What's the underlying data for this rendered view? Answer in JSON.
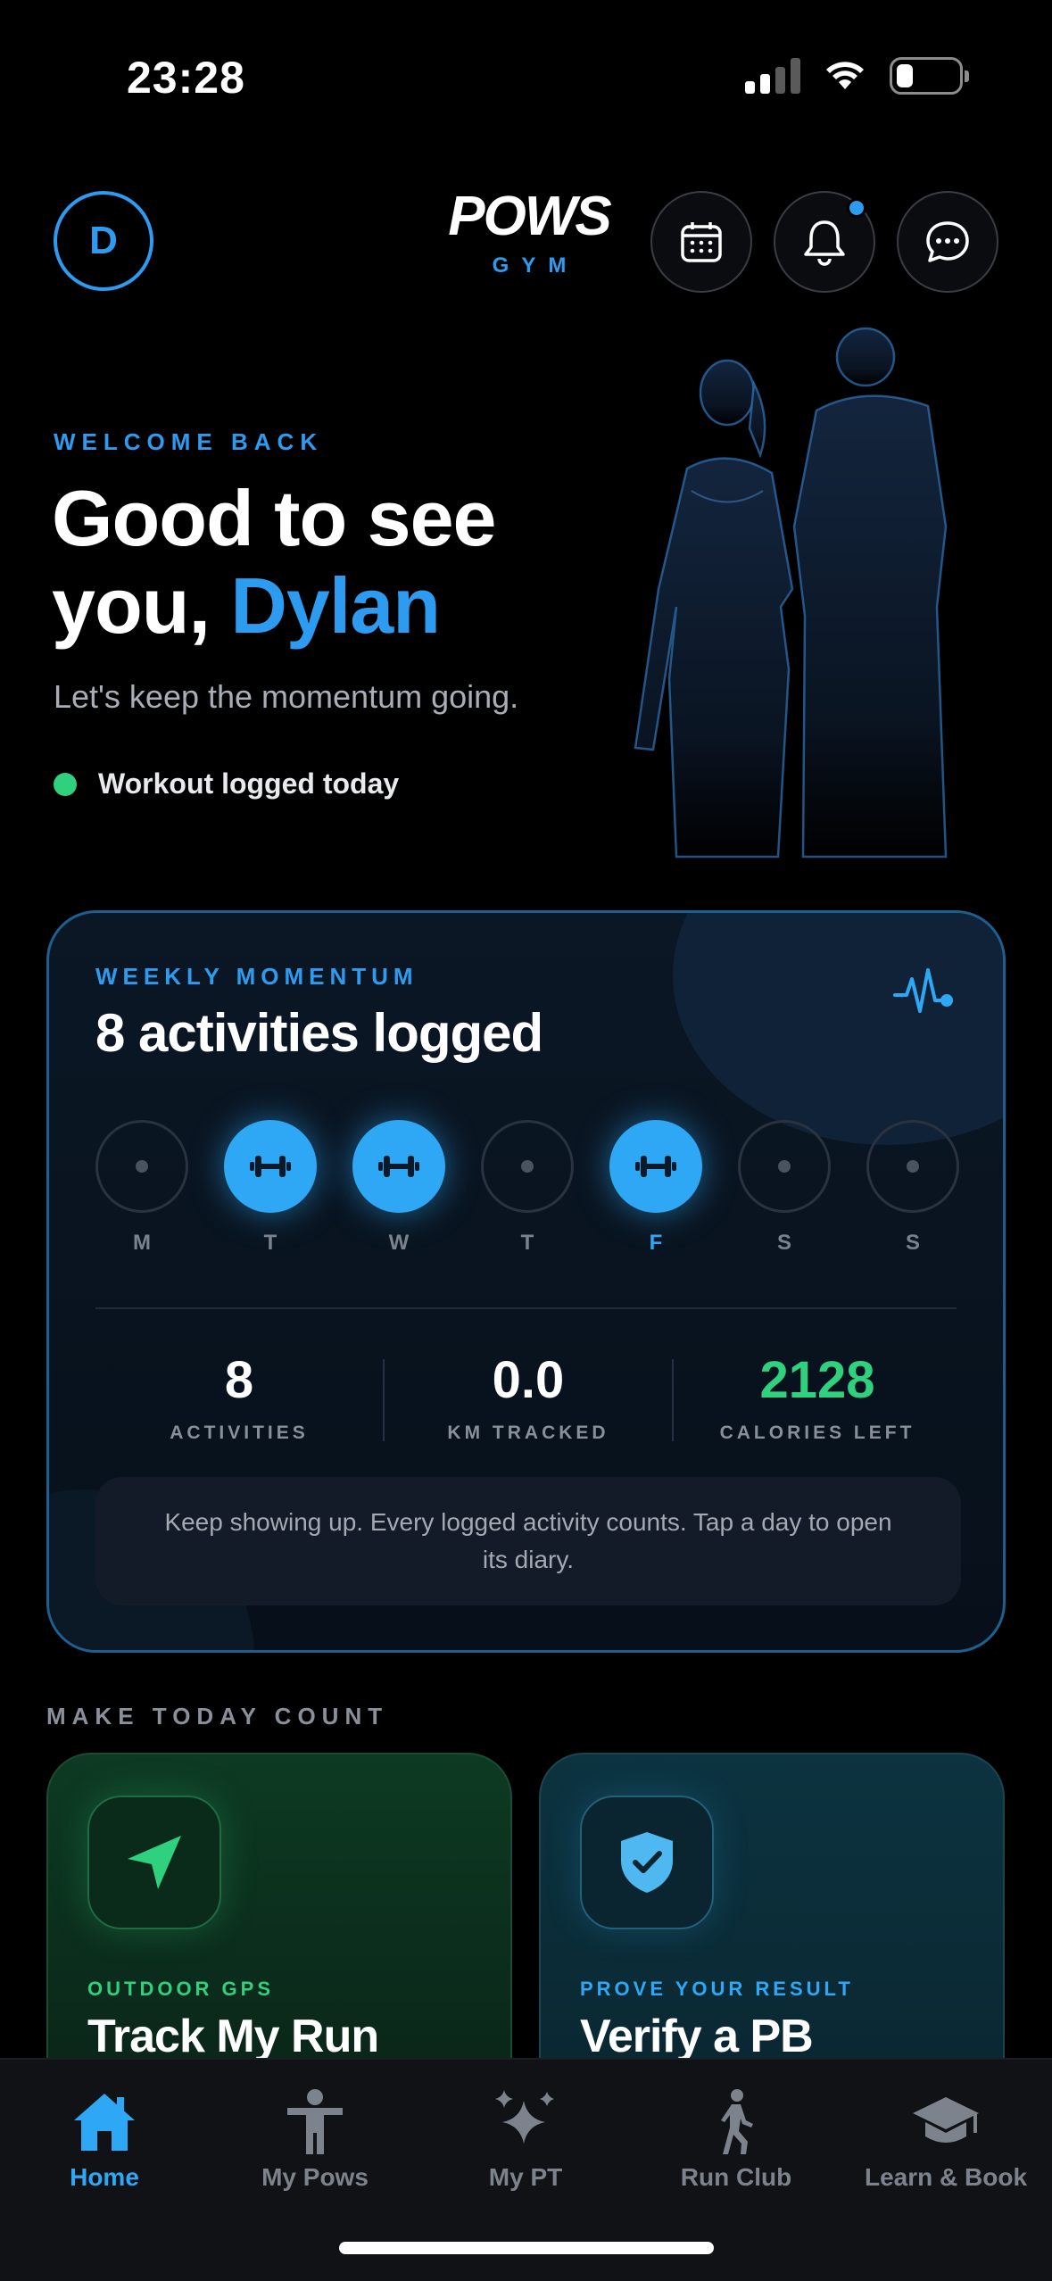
{
  "status_bar": {
    "time": "23:28"
  },
  "header": {
    "avatar_initial": "D",
    "logo_main": "POWS",
    "logo_sub": "GYM",
    "icons": [
      "calendar-icon",
      "bell-icon",
      "chat-icon"
    ],
    "has_notification": true
  },
  "hero": {
    "eyebrow": "WELCOME BACK",
    "greeting_line1": "Good to see",
    "greeting_line2_prefix": "you,",
    "name": "Dylan",
    "subtitle": "Let's keep the momentum going.",
    "status_text": "Workout logged today"
  },
  "weekly": {
    "eyebrow": "WEEKLY MOMENTUM",
    "title": "8 activities logged",
    "days": [
      {
        "letter": "M",
        "active": false,
        "today": false
      },
      {
        "letter": "T",
        "active": true,
        "today": false
      },
      {
        "letter": "W",
        "active": true,
        "today": false
      },
      {
        "letter": "T",
        "active": false,
        "today": false
      },
      {
        "letter": "F",
        "active": true,
        "today": true
      },
      {
        "letter": "S",
        "active": false,
        "today": false
      },
      {
        "letter": "S",
        "active": false,
        "today": false
      }
    ],
    "stats": [
      {
        "value": "8",
        "label": "ACTIVITIES"
      },
      {
        "value": "0.0",
        "label": "KM TRACKED"
      },
      {
        "value": "2128",
        "label": "CALORIES LEFT"
      }
    ],
    "tip": "Keep showing up. Every logged activity counts. Tap a day to open its diary."
  },
  "today": {
    "section_label": "MAKE TODAY COUNT",
    "run": {
      "eyebrow": "OUTDOOR GPS",
      "title": "Track My Run"
    },
    "pb": {
      "eyebrow": "PROVE YOUR RESULT",
      "title": "Verify a PB"
    }
  },
  "tabbar": {
    "tabs": [
      {
        "label": "Home",
        "icon": "home-icon",
        "active": true
      },
      {
        "label": "My Pows",
        "icon": "person-icon",
        "active": false
      },
      {
        "label": "My PT",
        "icon": "sparkles-icon",
        "active": false
      },
      {
        "label": "Run Club",
        "icon": "walker-icon",
        "active": false
      },
      {
        "label": "Learn & Book",
        "icon": "graduation-cap-icon",
        "active": false
      }
    ]
  },
  "colors": {
    "accent": "#2d9cf0",
    "success": "#2fd17e",
    "background": "#000000"
  }
}
